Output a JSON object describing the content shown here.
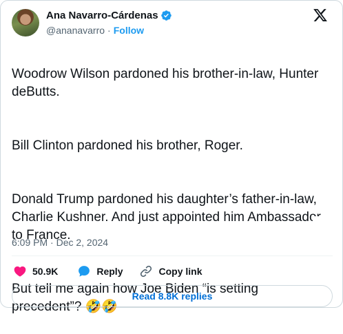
{
  "author": {
    "name": "Ana Navarro-Cárdenas",
    "handle": "@ananavarro",
    "separator": "·",
    "follow_label": "Follow"
  },
  "tweet": {
    "paragraphs": [
      "Woodrow Wilson pardoned his brother-in-law, Hunter deButts.",
      "Bill Clinton pardoned his brother, Roger.",
      "Donald Trump pardoned his daughter’s father-in-law, Charlie Kushner. And just appointed him Ambassador to France.",
      "But tell me again how Joe Biden “is setting precedent”? 🤣🤣"
    ],
    "timestamp": "6:09 PM · Dec 2, 2024"
  },
  "actions": {
    "likes": "50.9K",
    "reply_label": "Reply",
    "copy_link_label": "Copy link"
  },
  "footer": {
    "read_replies_label": "Read 8.8K replies"
  },
  "colors": {
    "accent": "#1d9bf0",
    "like": "#f91880",
    "secondary_text": "#536471"
  },
  "icons": [
    "verified-badge-icon",
    "x-logo-icon",
    "heart-icon",
    "reply-bubble-icon",
    "link-icon"
  ]
}
